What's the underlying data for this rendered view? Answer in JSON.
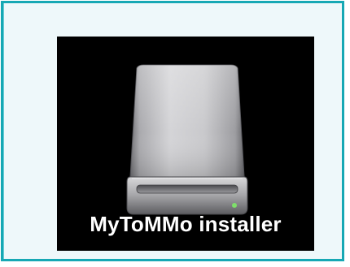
{
  "desktop": {
    "background_color": "#000000",
    "drive": {
      "icon": "external-drive-icon",
      "label": "MyToMMo installer",
      "led_color": "#7ee06a"
    }
  },
  "frame": {
    "border_color": "#16a8b4",
    "background_color": "#eef8fa"
  }
}
